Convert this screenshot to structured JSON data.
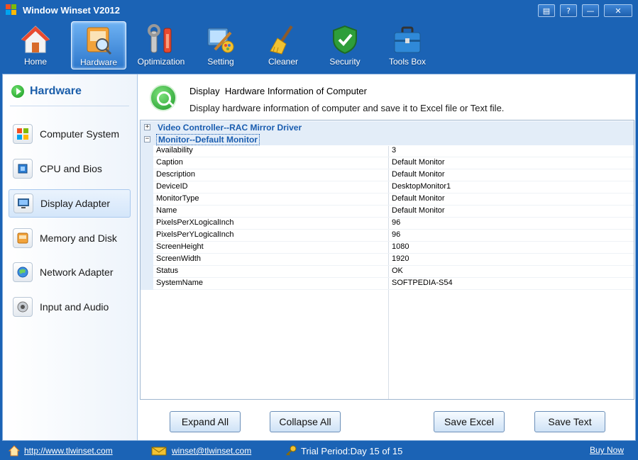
{
  "window": {
    "title": "Window Winset V2012",
    "controls": [
      {
        "name": "options",
        "glyph": "▤"
      },
      {
        "name": "help",
        "glyph": "?"
      },
      {
        "name": "minimize",
        "glyph": "—"
      },
      {
        "name": "close",
        "glyph": "✕"
      }
    ]
  },
  "toolbar": {
    "items": [
      {
        "label": "Home",
        "icon": "home-icon",
        "active": false
      },
      {
        "label": "Hardware",
        "icon": "hardware-icon",
        "active": true
      },
      {
        "label": "Optimization",
        "icon": "optimization-icon",
        "active": false
      },
      {
        "label": "Setting",
        "icon": "setting-icon",
        "active": false
      },
      {
        "label": "Cleaner",
        "icon": "broom-icon",
        "active": false
      },
      {
        "label": "Security",
        "icon": "shield-icon",
        "active": false
      },
      {
        "label": "Tools Box",
        "icon": "toolbox-icon",
        "active": false
      }
    ]
  },
  "sidebar": {
    "title": "Hardware",
    "items": [
      {
        "label": "Computer System",
        "icon": "windows-icon",
        "active": false
      },
      {
        "label": "CPU and Bios",
        "icon": "chip-icon",
        "active": false
      },
      {
        "label": "Display Adapter",
        "icon": "monitor-icon",
        "active": true
      },
      {
        "label": "Memory and Disk",
        "icon": "memory-icon",
        "active": false
      },
      {
        "label": "Network Adapter",
        "icon": "globe-icon",
        "active": false
      },
      {
        "label": "Input and Audio",
        "icon": "speaker-icon",
        "active": false
      }
    ]
  },
  "info": {
    "title": "Display  Hardware Information of Computer",
    "description": "Display hardware information of computer and save it to Excel file or Text file."
  },
  "grid": {
    "groups": [
      {
        "label": "Video Controller--RAC Mirror Driver",
        "expanded": false,
        "toggle": "+"
      },
      {
        "label": "Monitor--Default Monitor",
        "expanded": true,
        "toggle": "−"
      }
    ],
    "properties": [
      {
        "name": "Availability",
        "value": "3"
      },
      {
        "name": "Caption",
        "value": "Default Monitor"
      },
      {
        "name": "Description",
        "value": "Default Monitor"
      },
      {
        "name": "DeviceID",
        "value": "DesktopMonitor1"
      },
      {
        "name": "MonitorType",
        "value": "Default Monitor"
      },
      {
        "name": "Name",
        "value": "Default Monitor"
      },
      {
        "name": "PixelsPerXLogicalInch",
        "value": "96"
      },
      {
        "name": "PixelsPerYLogicalInch",
        "value": "96"
      },
      {
        "name": "ScreenHeight",
        "value": "1080"
      },
      {
        "name": "ScreenWidth",
        "value": "1920"
      },
      {
        "name": "Status",
        "value": "OK"
      },
      {
        "name": "SystemName",
        "value": "SOFTPEDIA-S54"
      }
    ]
  },
  "buttons": {
    "expand_all": "Expand All",
    "collapse_all": "Collapse All",
    "save_excel": "Save Excel",
    "save_text": "Save Text"
  },
  "statusbar": {
    "website": "http://www.tlwinset.com",
    "email": "winset@tlwinset.com",
    "trial": "Trial Period:Day 15 of 15",
    "buy": "Buy Now"
  }
}
